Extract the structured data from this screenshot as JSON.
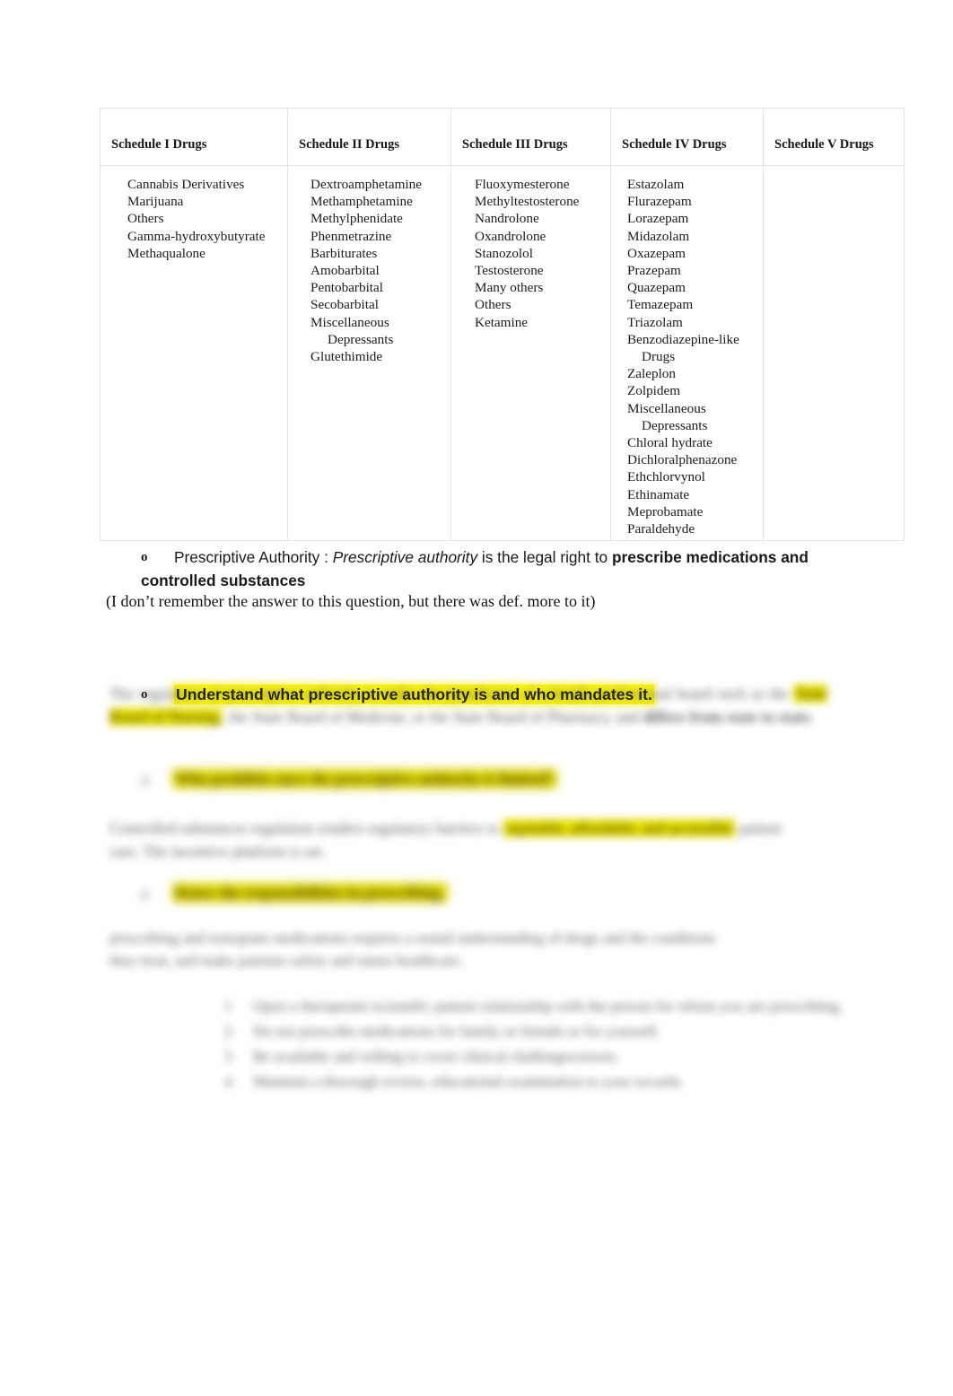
{
  "document": {
    "type": "study-notes",
    "page_background": "#ffffff",
    "highlight_color": "#faf211",
    "text_color": "#1a1a1a",
    "table_border_color": "#e3e3e3"
  },
  "table": {
    "name": "controlled-substance-schedules",
    "columns": [
      {
        "header": "Schedule I Drugs",
        "items": [
          {
            "text": "Cannabis Derivatives",
            "indent": false
          },
          {
            "text": "Marijuana",
            "indent": false
          },
          {
            "text": "Others",
            "indent": false
          },
          {
            "text": "Gamma-hydroxybutyrate",
            "indent": false
          },
          {
            "text": "Methaqualone",
            "indent": false
          }
        ]
      },
      {
        "header": "Schedule II Drugs",
        "items": [
          {
            "text": "Dextroamphetamine",
            "indent": false
          },
          {
            "text": "Methamphetamine",
            "indent": false
          },
          {
            "text": "Methylphenidate",
            "indent": false
          },
          {
            "text": "Phenmetrazine",
            "indent": false
          },
          {
            "text": "Barbiturates",
            "indent": false
          },
          {
            "text": "Amobarbital",
            "indent": false
          },
          {
            "text": "Pentobarbital",
            "indent": false
          },
          {
            "text": "Secobarbital",
            "indent": false
          },
          {
            "text": "Miscellaneous",
            "indent": false
          },
          {
            "text": "Depressants",
            "indent": true
          },
          {
            "text": "Glutethimide",
            "indent": false
          }
        ]
      },
      {
        "header": "Schedule III Drugs",
        "items": [
          {
            "text": "Fluoxymesterone",
            "indent": false
          },
          {
            "text": "Methyltestosterone",
            "indent": false
          },
          {
            "text": "Nandrolone",
            "indent": false
          },
          {
            "text": "Oxandrolone",
            "indent": false
          },
          {
            "text": "Stanozolol",
            "indent": false
          },
          {
            "text": "Testosterone",
            "indent": false
          },
          {
            "text": "Many others",
            "indent": false
          },
          {
            "text": "Others",
            "indent": false
          },
          {
            "text": "Ketamine",
            "indent": false
          }
        ]
      },
      {
        "header": "Schedule IV Drugs",
        "items": [
          {
            "text": "Estazolam",
            "indent": false
          },
          {
            "text": "Flurazepam",
            "indent": false
          },
          {
            "text": "Lorazepam",
            "indent": false
          },
          {
            "text": "Midazolam",
            "indent": false
          },
          {
            "text": "Oxazepam",
            "indent": false
          },
          {
            "text": "Prazepam",
            "indent": false
          },
          {
            "text": "Quazepam",
            "indent": false
          },
          {
            "text": "Temazepam",
            "indent": false
          },
          {
            "text": "Triazolam",
            "indent": false
          },
          {
            "text": "Benzodiazepine-like",
            "indent": false
          },
          {
            "text": "Drugs",
            "indent": true
          },
          {
            "text": "Zaleplon",
            "indent": false
          },
          {
            "text": "Zolpidem",
            "indent": false
          },
          {
            "text": "Miscellaneous",
            "indent": false
          },
          {
            "text": "Depressants",
            "indent": true
          },
          {
            "text": "Chloral hydrate",
            "indent": false
          },
          {
            "text": "Dichloralphenazone",
            "indent": false
          },
          {
            "text": "Ethchlorvynol",
            "indent": false
          },
          {
            "text": "Ethinamate",
            "indent": false
          },
          {
            "text": "Meprobamate",
            "indent": false
          },
          {
            "text": "Paraldehyde",
            "indent": false
          }
        ]
      },
      {
        "header": "Schedule V Drugs",
        "items": []
      }
    ]
  },
  "content": {
    "bullet_marker": "o",
    "prescriptive_bullet": {
      "lead": "Prescriptive Authority : ",
      "italic": "Prescriptive authority",
      "middle": " is the legal right to ",
      "bold": "prescribe medications and controlled substances"
    },
    "note": "(I don’t remember the answer to this question, but there was def. more to it)",
    "understand_bullet": {
      "text": "Understand what prescriptive authority is and who mandates it.",
      "highlighted": true
    }
  },
  "obscured": {
    "note": "The following passages are rendered out-of-focus in the source screenshot and their wording is not legible.",
    "paragraph_1": {
      "before_highlight": "The regulation of prescriptive authority is under the jurisdiction of a health professional board such as the",
      "highlight": "State Board of Nursing",
      "after_highlight": ", the State Board of Medicine, or the State Board of Pharmacy, and",
      "trailing_bold": "differs from state to state."
    },
    "bullet_1": {
      "marker": "o",
      "text": "Who prohibits once the prescriptive authority is limited?"
    },
    "paragraph_2": {
      "before_highlight": "Controlled substances regulation renders regulatory barriers to",
      "highlight": "equitable, affordable, and accessible",
      "after_highlight": "patient care. The incentive platform is set.",
      "highlight_2": "accessible"
    },
    "bullet_2": {
      "marker": "o",
      "text": "Know the responsibilities in prescribing."
    },
    "paragraph_3": "prescribing and nonopiate medications requires a sound understanding of drugs and the conditions they treat, and make patients safety and status healthcare.",
    "numbered_list": {
      "items": [
        "Open a therapeutic/scientific patient relationship with the person for whom you are prescribing.",
        "Do not prescribe medications for family or friends or for yourself.",
        "Be available and willing to cover clinical challenges/errors.",
        "Maintain a thorough review, educational examination to your records."
      ],
      "markers": [
        "1",
        "2",
        "3",
        "4"
      ]
    }
  }
}
